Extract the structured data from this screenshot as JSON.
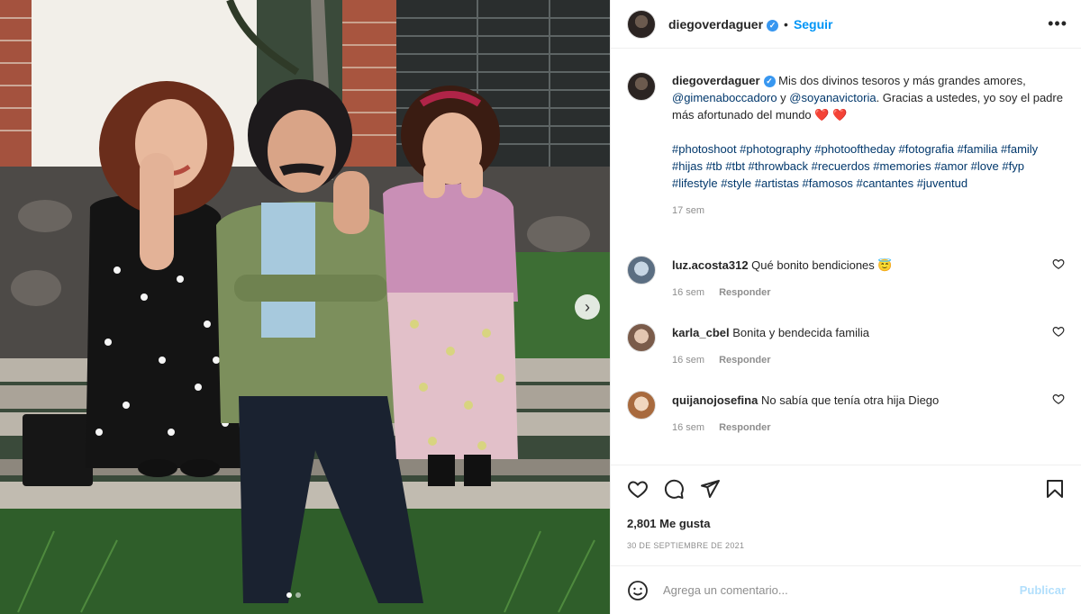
{
  "post": {
    "username": "diegoverdaguer",
    "follow_label": "Seguir",
    "separator": "•",
    "more_label": "•••",
    "caption": {
      "text_before": "Mis dos divinos tesoros y más grandes amores, ",
      "mention_1": "@gimenaboccadoro",
      "connector": " y ",
      "mention_2": "@soyanavictoria",
      "text_after": ". Gracias a ustedes, yo soy el padre más afortunado del mundo ",
      "hearts": "❤️ ❤️",
      "hashtags": "#photoshoot #photography #photooftheday #fotografia #familia #family #hijas #tb #tbt #throwback #recuerdos #memories #amor #love #fyp #lifestyle #style #artistas #famosos #cantantes #juventud",
      "time": "17 sem"
    },
    "comments": [
      {
        "username": "luz.acosta312",
        "text": "Qué bonito bendiciones 😇",
        "time": "16 sem",
        "reply_label": "Responder"
      },
      {
        "username": "karla_cbel",
        "text": "Bonita y bendecida familia",
        "time": "16 sem",
        "reply_label": "Responder"
      },
      {
        "username": "quijanojosefina",
        "text": "No sabía que tenía otra hija Diego",
        "time": "16 sem",
        "reply_label": "Responder"
      }
    ],
    "likes": "2,801 Me gusta",
    "date": "30 DE SEPTIEMBRE DE 2021",
    "comment_placeholder": "Agrega un comentario...",
    "publish_label": "Publicar"
  },
  "carousel": {
    "total": 2,
    "active": 1
  },
  "colors": {
    "accent": "#0095f6",
    "link": "#00376b",
    "muted": "#8e8e8e",
    "heart": "#e0245e"
  },
  "icons": [
    "verified-badge-icon",
    "more-options-icon",
    "heart-icon",
    "comment-icon",
    "share-icon",
    "bookmark-icon",
    "emoji-icon",
    "chevron-right-icon"
  ]
}
